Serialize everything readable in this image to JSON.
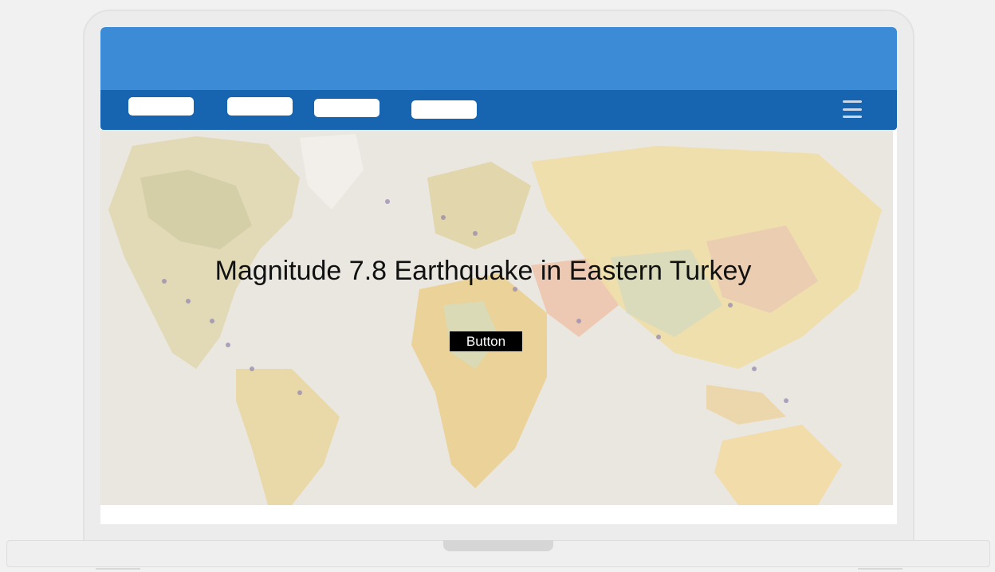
{
  "hero": {
    "title": "Magnitude 7.8 Earthquake in Eastern Turkey",
    "button_label": "Button",
    "background": "world-map"
  },
  "nav": {
    "items": [
      "",
      "",
      "",
      ""
    ],
    "menu_icon": "hamburger-menu-icon"
  },
  "colors": {
    "header": "#3b8bd6",
    "navbar": "#1764b1",
    "button": "#000000"
  }
}
